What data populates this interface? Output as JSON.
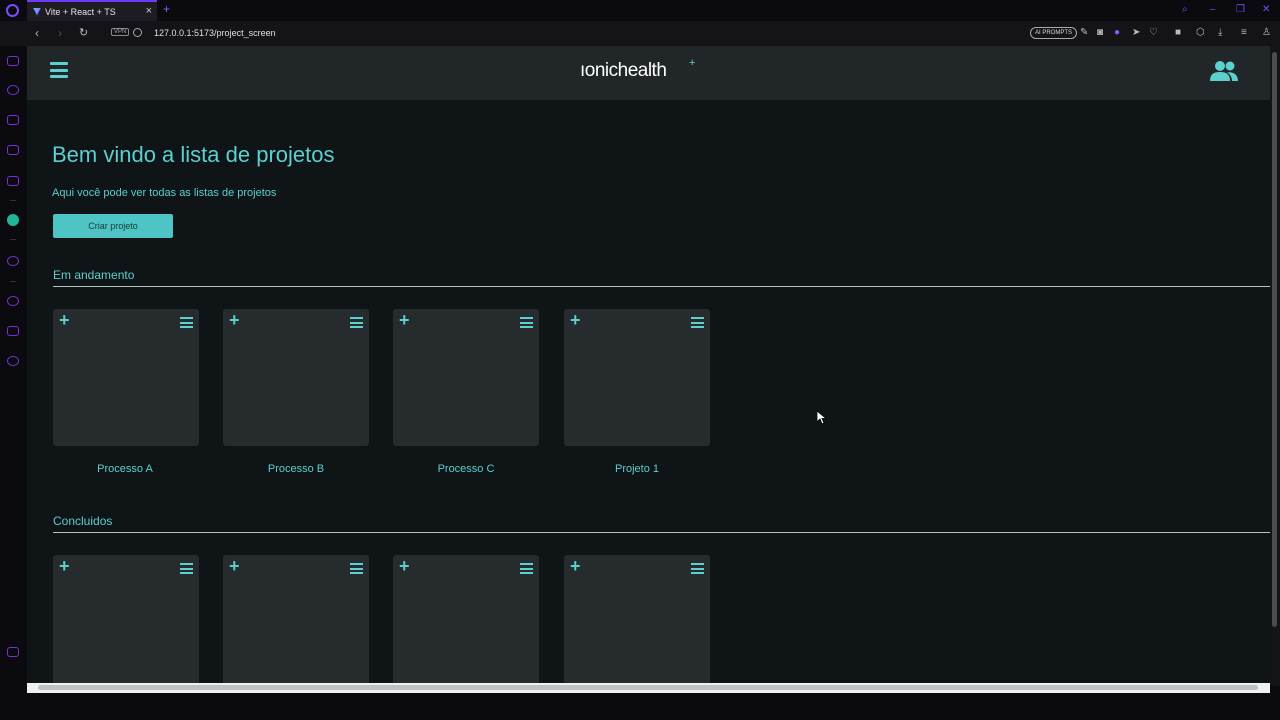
{
  "browser": {
    "tab_title": "Vite + React + TS",
    "tab_close": "×",
    "new_tab": "+",
    "url": "127.0.0.1:5173/project_screen",
    "vpn_label": "VPN",
    "ai_prompts_label": "AI PROMPTS"
  },
  "app": {
    "brand": "ıonichealth",
    "brand_mark": "+"
  },
  "main": {
    "title": "Bem vindo a lista de projetos",
    "subtitle": "Aqui você pode ver todas as listas de projetos",
    "create_button": "Criar projeto"
  },
  "sections": [
    {
      "heading": "Em andamento",
      "cards": [
        {
          "label": "Processo A"
        },
        {
          "label": "Processo B"
        },
        {
          "label": "Processo C"
        },
        {
          "label": "Projeto 1"
        }
      ]
    },
    {
      "heading": "Concluidos",
      "cards": [
        {
          "label": ""
        },
        {
          "label": ""
        },
        {
          "label": ""
        },
        {
          "label": ""
        }
      ]
    }
  ],
  "colors": {
    "accent": "#5ccfcf",
    "appbar": "#212728",
    "page_bg": "#0f1416",
    "card_bg": "#262b2d"
  }
}
